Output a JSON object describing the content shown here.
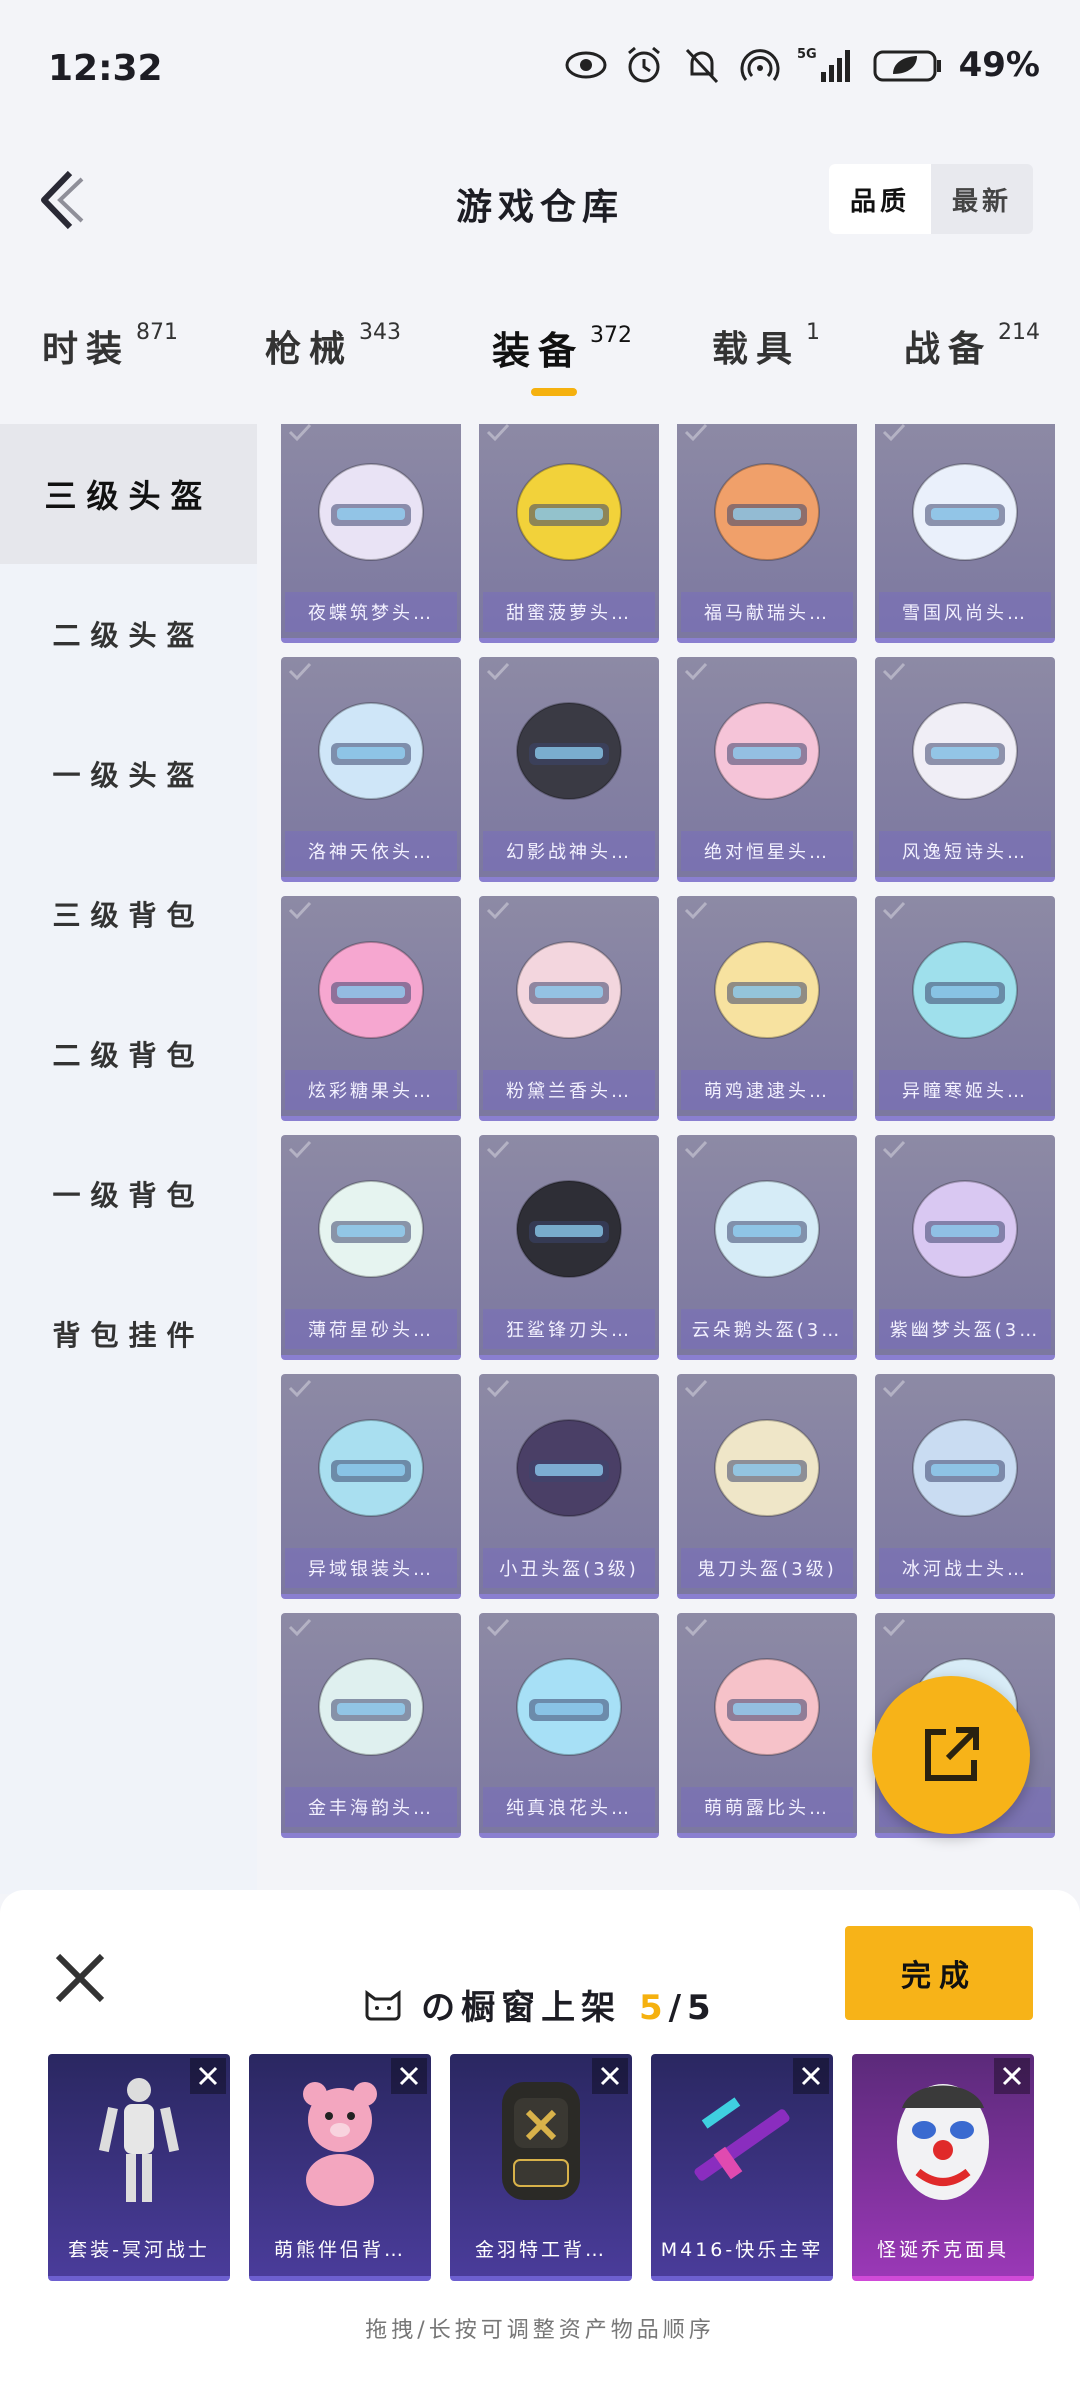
{
  "status_bar": {
    "time": "12:32",
    "network": "5G",
    "battery": "49%"
  },
  "header": {
    "title": "游戏仓库",
    "sort": [
      "品质",
      "最新"
    ],
    "sort_active": 0
  },
  "tabs": [
    {
      "label": "时装",
      "count": "871"
    },
    {
      "label": "枪械",
      "count": "343"
    },
    {
      "label": "装备",
      "count": "372"
    },
    {
      "label": "载具",
      "count": "1"
    },
    {
      "label": "战备",
      "count": "214"
    }
  ],
  "active_tab": 2,
  "sidebar": [
    "三级头盔",
    "二级头盔",
    "一级头盔",
    "三级背包",
    "二级背包",
    "一级背包",
    "背包挂件"
  ],
  "grid_items": [
    "夜蝶筑梦头…",
    "甜蜜菠萝头…",
    "福马献瑞头…",
    "雪国风尚头…",
    "洛神天依头…",
    "幻影战神头…",
    "绝对恒星头…",
    "风逸短诗头…",
    "炫彩糖果头…",
    "粉黛兰香头…",
    "萌鸡逮逮头…",
    "异瞳寒姬头…",
    "薄荷星砂头…",
    "狂鲨锋刃头…",
    "云朵鹅头盔(3…",
    "紫幽梦头盔(3…",
    "异域银装头…",
    "小丑头盔(3级)",
    "鬼刀头盔(3级)",
    "冰河战士头…",
    "金丰海韵头…",
    "纯真浪花头…",
    "萌萌露比头…",
    "…"
  ],
  "bottom_sheet": {
    "title_prefix": "の橱窗上架",
    "current": "5",
    "total": "/5",
    "done": "完成",
    "items": [
      "套装-冥河战士",
      "萌熊伴侣背…",
      "金羽特工背…",
      "M416-快乐主宰",
      "怪诞乔克面具"
    ],
    "hint": "拖拽/长按可调整资产物品顺序"
  },
  "colors": {
    "accent": "#f7b318",
    "card": "#8a86a6",
    "shelf": "#2f2b6a"
  }
}
